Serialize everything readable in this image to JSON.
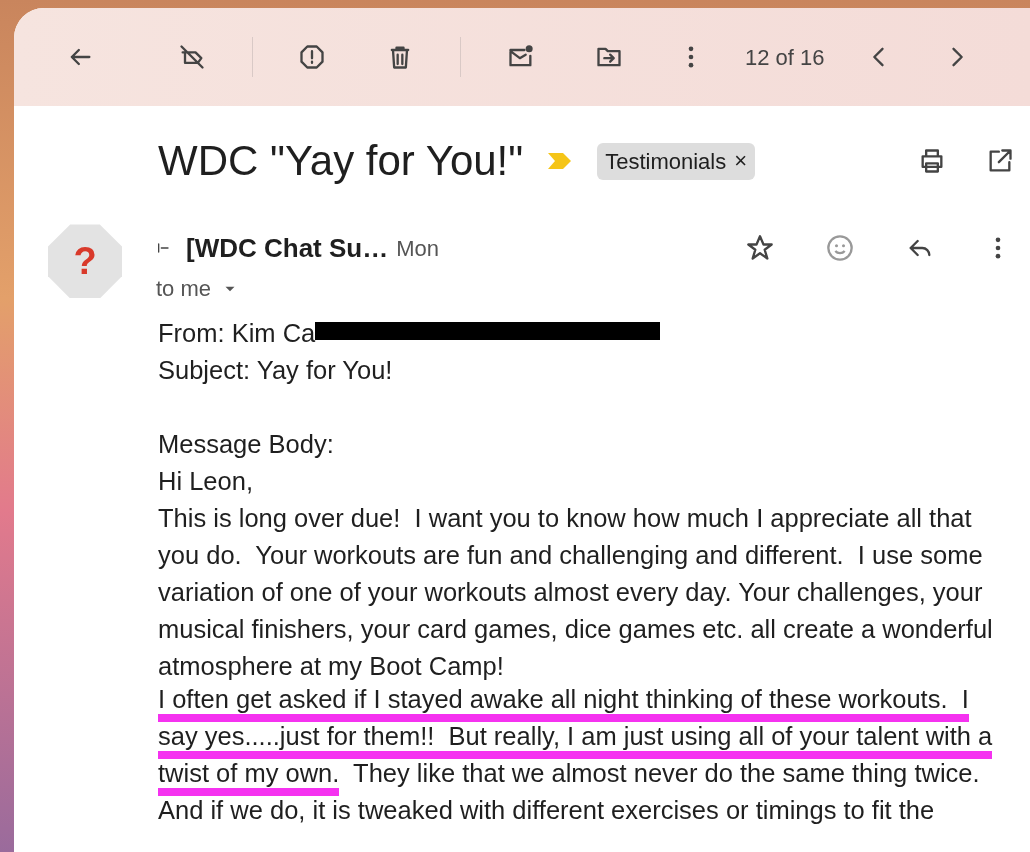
{
  "toolbar": {
    "counter": "12 of 16"
  },
  "message": {
    "subject": "WDC \"Yay for You!\"",
    "important": true,
    "labels": [
      {
        "name": "Testimonials",
        "remove": "×"
      }
    ],
    "sender": {
      "avatar": "?",
      "name": "[WDC Chat Su…",
      "time": "Mon",
      "starred": false,
      "recipient": "to me"
    },
    "body": [
      {
        "kind": "redacted",
        "text": "From: Kim Ca"
      },
      {
        "kind": "text",
        "text": "Subject: Yay for You!"
      },
      {
        "kind": "gap"
      },
      {
        "kind": "text",
        "text": "Message Body:"
      },
      {
        "kind": "text",
        "text": "Hi Leon,"
      },
      {
        "kind": "text",
        "text": "This is long over due!  I want you to know how much I appreciate all that you do.  Your workouts are fun and challenging and different.  I use some variation of one of your workouts almost every day. Your challenges, your musical finishers, your card games, dice games etc. all create a wonderful atmosphere at my Boot Camp!"
      },
      {
        "kind": "lines",
        "lines": [
          [
            {
              "text": "I often get asked if I stayed awake all night thinking of these workouts.  I",
              "underlined": true
            }
          ],
          [
            {
              "text": "say yes.....just for them!!  But really, I am just using all of your talent with a",
              "underlined": true
            }
          ],
          [
            {
              "text": "twist of my own.",
              "underlined": true
            },
            {
              "text": "  They like that we almost never do the same thing twice.",
              "underlined": false
            }
          ],
          [
            {
              "text": "And if we do, it is tweaked with different exercises or timings to fit the",
              "underlined": false
            }
          ]
        ]
      }
    ]
  }
}
